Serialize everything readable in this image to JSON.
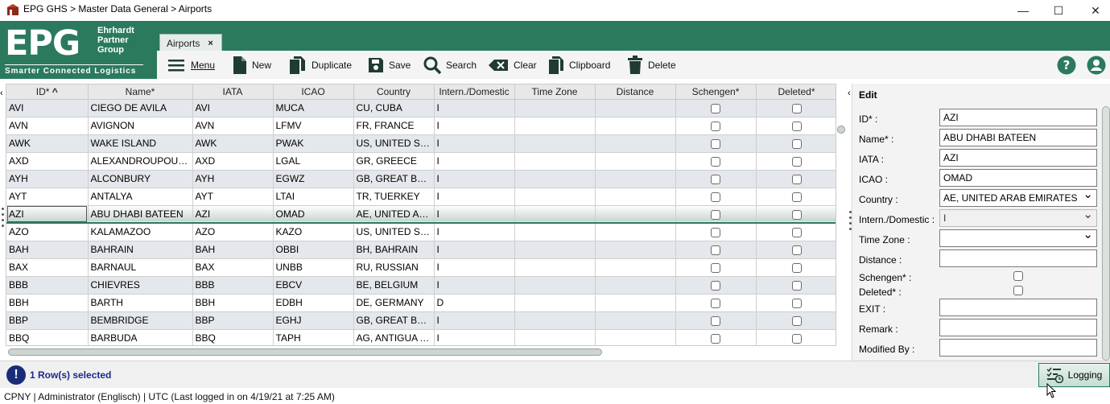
{
  "window": {
    "title": "EPG GHS > Master Data General > Airports",
    "minimize": "—",
    "maximize": "☐",
    "close": "✕"
  },
  "logo": {
    "brand": "EPG",
    "sub_line1": "Ehrhardt",
    "sub_line2": "Partner",
    "sub_line3": "Group",
    "tagline": "Smarter Connected Logistics"
  },
  "tab": {
    "label": "Airports",
    "close": "×"
  },
  "toolbar": {
    "menu": "Menu",
    "new": "New",
    "duplicate": "Duplicate",
    "save": "Save",
    "search": "Search",
    "clear": "Clear",
    "clipboard": "Clipboard",
    "delete": "Delete"
  },
  "grid": {
    "columns": [
      "ID*",
      "Name*",
      "IATA",
      "ICAO",
      "Country",
      "Intern./Domestic",
      "Time Zone",
      "Distance",
      "Schengen*",
      "Deleted*"
    ],
    "rows": [
      {
        "id": "AVI",
        "name": "CIEGO DE AVILA",
        "iata": "AVI",
        "icao": "MUCA",
        "country": "CU, CUBA",
        "intern": "I"
      },
      {
        "id": "AVN",
        "name": "AVIGNON",
        "iata": "AVN",
        "icao": "LFMV",
        "country": "FR, FRANCE",
        "intern": "I"
      },
      {
        "id": "AWK",
        "name": "WAKE ISLAND",
        "iata": "AWK",
        "icao": "PWAK",
        "country": "US, UNITED STA...",
        "intern": "I"
      },
      {
        "id": "AXD",
        "name": "ALEXANDROUPOULIS",
        "iata": "AXD",
        "icao": "LGAL",
        "country": "GR, GREECE",
        "intern": "I"
      },
      {
        "id": "AYH",
        "name": "ALCONBURY",
        "iata": "AYH",
        "icao": "EGWZ",
        "country": "GB, GREAT BRIT...",
        "intern": "I"
      },
      {
        "id": "AYT",
        "name": "ANTALYA",
        "iata": "AYT",
        "icao": "LTAI",
        "country": "TR, TUERKEY",
        "intern": "I"
      },
      {
        "id": "AZI",
        "name": "ABU DHABI BATEEN",
        "iata": "AZI",
        "icao": "OMAD",
        "country": "AE, UNITED ARA...",
        "intern": "I"
      },
      {
        "id": "AZO",
        "name": "KALAMAZOO",
        "iata": "AZO",
        "icao": "KAZO",
        "country": "US, UNITED STA...",
        "intern": "I"
      },
      {
        "id": "BAH",
        "name": "BAHRAIN",
        "iata": "BAH",
        "icao": "OBBI",
        "country": "BH, BAHRAIN",
        "intern": "I"
      },
      {
        "id": "BAX",
        "name": "BARNAUL",
        "iata": "BAX",
        "icao": "UNBB",
        "country": "RU, RUSSIAN",
        "intern": "I"
      },
      {
        "id": "BBB",
        "name": "CHIEVRES",
        "iata": "BBB",
        "icao": "EBCV",
        "country": "BE, BELGIUM",
        "intern": "I"
      },
      {
        "id": "BBH",
        "name": "BARTH",
        "iata": "BBH",
        "icao": "EDBH",
        "country": "DE, GERMANY",
        "intern": "D"
      },
      {
        "id": "BBP",
        "name": "BEMBRIDGE",
        "iata": "BBP",
        "icao": "EGHJ",
        "country": "GB, GREAT BRIT...",
        "intern": "I"
      },
      {
        "id": "BBQ",
        "name": "BARBUDA",
        "iata": "BBQ",
        "icao": "TAPH",
        "country": "AG, ANTIGUA A...",
        "intern": "I"
      }
    ]
  },
  "edit": {
    "title": "Edit",
    "id_label": "ID* :",
    "id_value": "AZI",
    "name_label": "Name* :",
    "name_value": "ABU DHABI BATEEN",
    "iata_label": "IATA :",
    "iata_value": "AZI",
    "icao_label": "ICAO :",
    "icao_value": "OMAD",
    "country_label": "Country :",
    "country_value": "AE, UNITED ARAB EMIRATES",
    "intern_label": "Intern./Domestic :",
    "intern_value": "I",
    "timezone_label": "Time Zone :",
    "timezone_value": "",
    "distance_label": "Distance :",
    "schengen_label": "Schengen* :",
    "deleted_label": "Deleted* :",
    "exit_label": "EXIT :",
    "remark_label": "Remark :",
    "modified_label": "Modified By :"
  },
  "status": {
    "selection": "1 Row(s) selected",
    "info_glyph": "!",
    "logging": "Logging"
  },
  "footer": {
    "text": "CPNY | Administrator (Englisch) | UTC (Last logged in on 4/19/21 at 7:25 AM)"
  },
  "colors": {
    "brand_green": "#2b7a5e",
    "selection_blue": "#1a2a8a"
  }
}
